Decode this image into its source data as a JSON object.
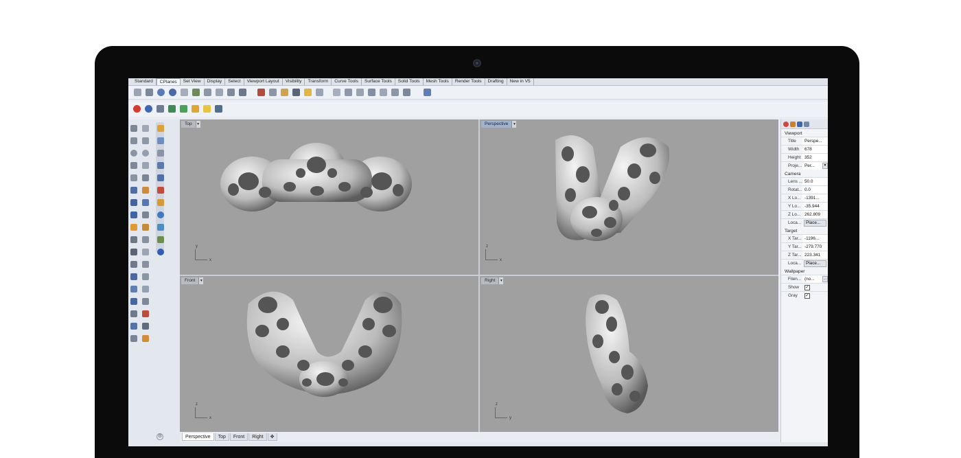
{
  "toolbar": {
    "tabs": [
      "Standard",
      "CPlanes",
      "Set View",
      "Display",
      "Select",
      "Viewport Layout",
      "Visibility",
      "Transform",
      "Curve Tools",
      "Surface Tools",
      "Solid Tools",
      "Mesh Tools",
      "Render Tools",
      "Drafting",
      "New in V5"
    ],
    "active_tab": "CPlanes"
  },
  "viewports": [
    {
      "name": "Top",
      "active": false,
      "axis_x": "x",
      "axis_y": "y"
    },
    {
      "name": "Perspective",
      "active": true,
      "axis_x": "x",
      "axis_y": "z"
    },
    {
      "name": "Front",
      "active": false,
      "axis_x": "x",
      "axis_y": "z"
    },
    {
      "name": "Right",
      "active": false,
      "axis_x": "y",
      "axis_y": "z"
    }
  ],
  "viewport_tabs": [
    "Perspective",
    "Top",
    "Front",
    "Right"
  ],
  "viewport_tabs_active": "Perspective",
  "properties": {
    "viewport_section": "Viewport",
    "title_label": "Title",
    "title_value": "Perspe...",
    "width_label": "Width",
    "width_value": "678",
    "height_label": "Height",
    "height_value": "352",
    "projection_label": "Proje...",
    "projection_value": "Per...",
    "camera_section": "Camera",
    "lens_label": "Lens ...",
    "lens_value": "50.0",
    "rotation_label": "Rotat...",
    "rotation_value": "0.0",
    "xloc_label": "X Lo...",
    "xloc_value": "-1391...",
    "yloc_label": "Y Lo...",
    "yloc_value": "-35.944",
    "zloc_label": "Z Lo...",
    "zloc_value": "262.809",
    "location_label": "Loca...",
    "place_button": "Place...",
    "target_section": "Target",
    "xtar_label": "X Tar...",
    "xtar_value": "-1196...",
    "ytar_label": "Y Tar...",
    "ytar_value": "-279.770",
    "ztar_label": "Z Tar...",
    "ztar_value": "223.341",
    "target_location_label": "Loca...",
    "target_place_button": "Place...",
    "wallpaper_section": "Wallpaper",
    "filename_label": "Filen...",
    "filename_value": "(no...",
    "filename_browse": "...",
    "show_label": "Show",
    "show_checked": "✓",
    "gray_label": "Gray",
    "gray_checked": "✓"
  },
  "colors": {
    "viewport_bg": "#a0a0a0",
    "active_viewport_label": "#9fb3cf",
    "bezel": "#0b0b0b"
  }
}
